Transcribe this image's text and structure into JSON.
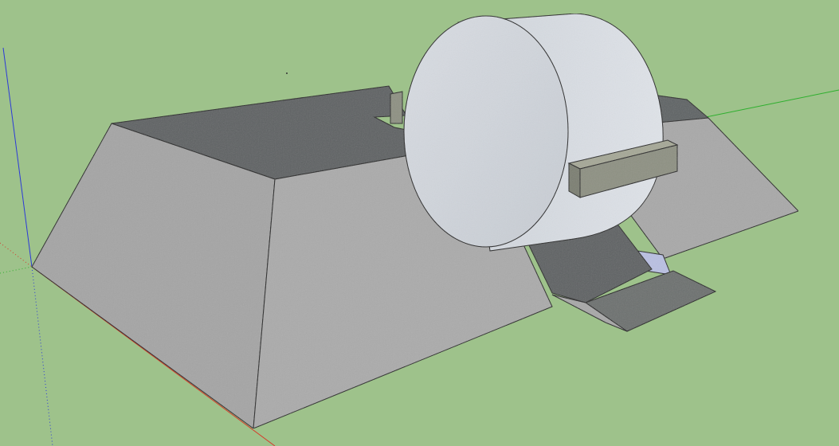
{
  "viewport": {
    "background_color": "#9ec28b",
    "tool_cursor": "orbit"
  },
  "axes": {
    "x_color": "#d63a2a",
    "y_color": "#2eaf2e",
    "z_color": "#2c3ad8"
  },
  "model": {
    "surface_light": "#b8b8b8",
    "surface_mid": "#a3a3a3",
    "surface_dark": "#636868",
    "drum_color": "#d2d7de",
    "drum_side": "#c6cbd2",
    "bracket_color": "#8e9183",
    "water_color": "#b9c0e2"
  }
}
